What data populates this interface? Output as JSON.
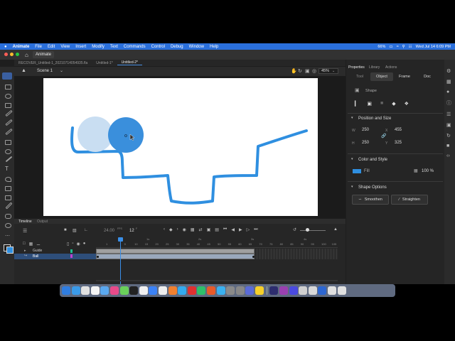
{
  "menubar": {
    "app_name": "Animate",
    "items": [
      "File",
      "Edit",
      "View",
      "Insert",
      "Modify",
      "Text",
      "Commands",
      "Control",
      "Debug",
      "Window",
      "Help"
    ],
    "battery": "66%",
    "datetime": "Wed Jul 14  6:09 PM"
  },
  "window": {
    "title": "Animate",
    "doc_tabs": [
      "RECOVER_Untitled-1_20210714054935.fla",
      "Untitled-1*",
      "Untitled-2*"
    ],
    "active_tab": 2
  },
  "scene": {
    "label": "Scene 1",
    "zoom": "45%"
  },
  "timeline": {
    "tabs": [
      "Timeline",
      "Output"
    ],
    "fps": "24.00",
    "fps_unit": "FPS",
    "current_frame": "12",
    "frame_unit": "F",
    "seconds": [
      "1s",
      "2s",
      "3s",
      "4s"
    ],
    "frame_numbers": [
      "1",
      "5",
      "10",
      "15",
      "20",
      "25",
      "30",
      "35",
      "40",
      "45",
      "50",
      "55",
      "60",
      "65",
      "70",
      "75",
      "80",
      "85",
      "90",
      "95",
      "100",
      "105"
    ],
    "layers": [
      {
        "name": "Guide",
        "color": "#1fbf8f"
      },
      {
        "name": "Ball",
        "color": "#c040d0",
        "selected": true
      }
    ]
  },
  "properties": {
    "panel_tabs": [
      "Properties",
      "Library",
      "Actions"
    ],
    "sub_tabs": [
      "Tool",
      "Object",
      "Frame",
      "Doc"
    ],
    "active_sub_tab": "Object",
    "object_type": "Shape",
    "position_size": {
      "title": "Position and Size",
      "w_label": "W",
      "w": "250",
      "h_label": "H",
      "h": "250",
      "x_label": "X",
      "x": "455",
      "y_label": "Y",
      "y": "325"
    },
    "color_style": {
      "title": "Color and Style",
      "fill_label": "Fill",
      "fill_color": "#2f8fe0",
      "alpha": "100 %"
    },
    "shape_options": {
      "title": "Shape Options",
      "smoothen": "Smoothen",
      "straighten": "Straighten"
    }
  },
  "stage_colors": {
    "ball": "#3a8fdc",
    "ghost": "#c9def2",
    "path": "#2f8fe0"
  },
  "dock_colors": [
    "#2f7de0",
    "#3a9ae8",
    "#e0e0e0",
    "#f4f4f4",
    "#5aa8ef",
    "#e84a8a",
    "#6ad05a",
    "#222222",
    "#f0f0f0",
    "#3b82f6",
    "#eeeeee",
    "#f08030",
    "#33aaee",
    "#e03030",
    "#2ebf6a",
    "#e85a2a",
    "#3ab0f0",
    "#8a8a8a",
    "#888888",
    "#5a6bd8",
    "#f6d02a",
    "#9a3ae0",
    "#2d2d6e",
    "#9a40b0",
    "#4a4ae0",
    "#d0d0d0",
    "#d8d8d8",
    "#2d66d0",
    "#e0e0e0",
    "#e0e0e0"
  ]
}
